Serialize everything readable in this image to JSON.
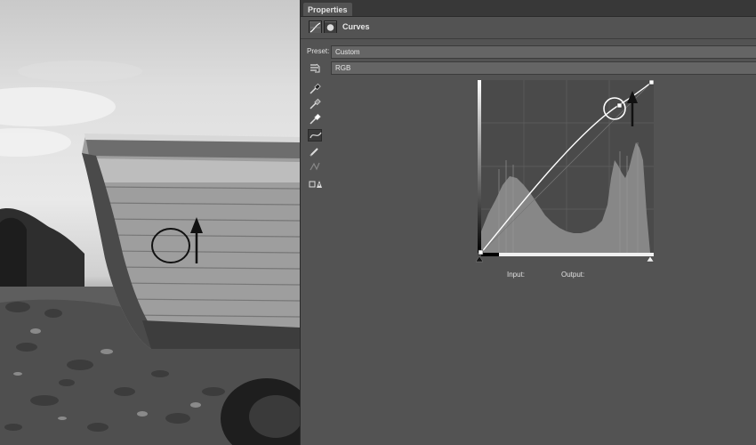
{
  "panel": {
    "tab_label": "Properties",
    "title": "Curves",
    "preset_label": "Preset:",
    "preset_value": "Custom",
    "channel_value": "RGB",
    "input_label": "Input:",
    "output_label": "Output:"
  },
  "icons": {
    "adjustment": "curves-adjustment-icon",
    "mask": "layer-mask-icon",
    "target_adjust": "hand-target-adjustment-icon",
    "black_point": "eyedropper-black-icon",
    "gray_point": "eyedropper-gray-icon",
    "white_point": "eyedropper-white-icon",
    "edit_points": "curve-points-icon",
    "draw": "pencil-draw-icon",
    "smooth": "smooth-curve-icon",
    "clipping": "clipping-warning-icon"
  },
  "curve_points": [
    [
      0,
      0
    ],
    [
      209,
      221
    ],
    [
      255,
      255
    ]
  ],
  "colors": {
    "panel_bg": "#535353",
    "histogram": "#8a8a8a",
    "graph_bg": "#4a4a4a",
    "curve": "#ffffff"
  }
}
